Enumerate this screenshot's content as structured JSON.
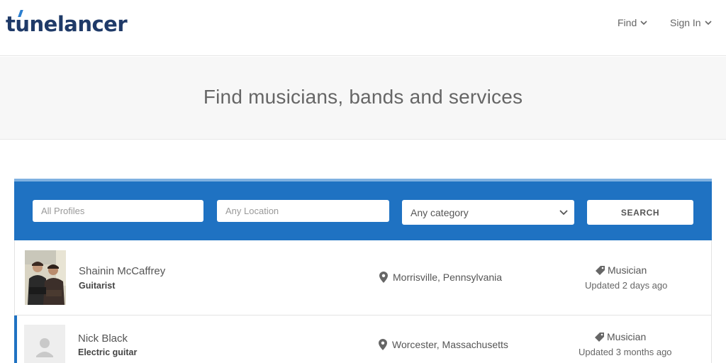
{
  "header": {
    "logo_text": "tunelancer",
    "nav": [
      {
        "label": "Find"
      },
      {
        "label": "Sign In"
      }
    ]
  },
  "hero": {
    "title": "Find musicians, bands and services"
  },
  "search": {
    "profiles_placeholder": "All Profiles",
    "location_placeholder": "Any Location",
    "category_value": "Any category",
    "button_label": "SEARCH"
  },
  "results": [
    {
      "name": "Shainin McCaffrey",
      "role": "Guitarist",
      "location": "Morrisville, Pennsylvania",
      "category": "Musician",
      "updated": "Updated 2 days ago",
      "avatar": "photo"
    },
    {
      "name": "Nick Black",
      "role": "Electric guitar",
      "location": "Worcester, Massachusetts",
      "category": "Musician",
      "updated": "Updated 3 months ago",
      "avatar": "placeholder-person-icon"
    }
  ],
  "colors": {
    "brand_navy": "#1f3a68",
    "accent_blue": "#1f72c2",
    "accent_light": "#7fb1e0"
  }
}
